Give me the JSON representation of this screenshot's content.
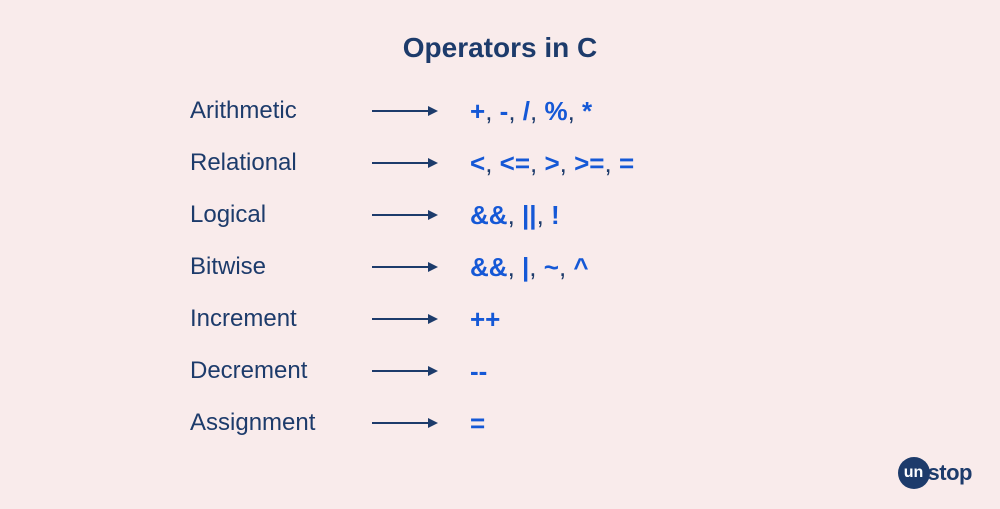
{
  "title": "Operators in C",
  "rows": [
    {
      "category": "Arithmetic",
      "operators": [
        "+",
        "-",
        "/",
        "%",
        "*"
      ]
    },
    {
      "category": "Relational",
      "operators": [
        "<",
        "<=",
        ">",
        ">=",
        "="
      ]
    },
    {
      "category": "Logical",
      "operators": [
        "&&",
        "||",
        "!"
      ]
    },
    {
      "category": "Bitwise",
      "operators": [
        "&&",
        "|",
        "~",
        "^"
      ]
    },
    {
      "category": "Increment",
      "operators": [
        "++"
      ]
    },
    {
      "category": "Decrement",
      "operators": [
        "--"
      ]
    },
    {
      "category": "Assignment",
      "operators": [
        "="
      ]
    }
  ],
  "logo": {
    "circle": "un",
    "text": "stop"
  }
}
